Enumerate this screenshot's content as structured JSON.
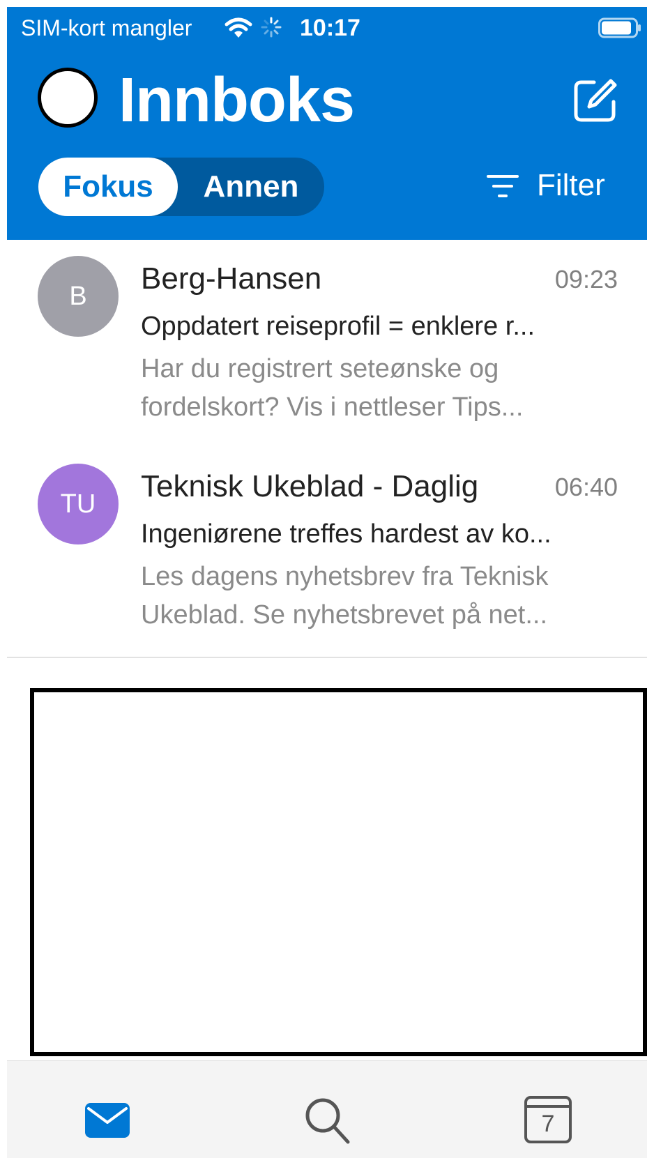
{
  "status_bar": {
    "carrier": "SIM-kort mangler",
    "time": "10:17"
  },
  "header": {
    "title": "Innboks",
    "tabs": {
      "focused": "Fokus",
      "other": "Annen"
    },
    "filter_label": "Filter"
  },
  "messages": [
    {
      "initials": "B",
      "avatar_color": "#a0a0a8",
      "sender": "Berg-Hansen",
      "time": "09:23",
      "subject": "Oppdatert reiseprofil = enklere r...",
      "preview_line1": "Har du registrert seteønske og",
      "preview_line2": "fordelskort? Vis i nettleser   Tips..."
    },
    {
      "initials": "TU",
      "avatar_color": "#a276dc",
      "sender": "Teknisk Ukeblad - Daglig",
      "time": "06:40",
      "subject": "Ingeniørene treffes hardest av ko...",
      "preview_line1": "Les dagens nyhetsbrev fra Teknisk",
      "preview_line2": "Ukeblad. Se nyhetsbrevet på net..."
    }
  ],
  "tabbar": {
    "calendar_day": "7"
  },
  "colors": {
    "brand": "#0078d4",
    "brand_dark": "#005a9e"
  },
  "icons": {
    "wifi": "wifi-icon",
    "activity": "spinner-icon",
    "battery": "battery-icon",
    "compose": "compose-icon",
    "filter": "filter-icon",
    "mail": "mail-icon",
    "search": "search-icon",
    "calendar": "calendar-icon"
  }
}
